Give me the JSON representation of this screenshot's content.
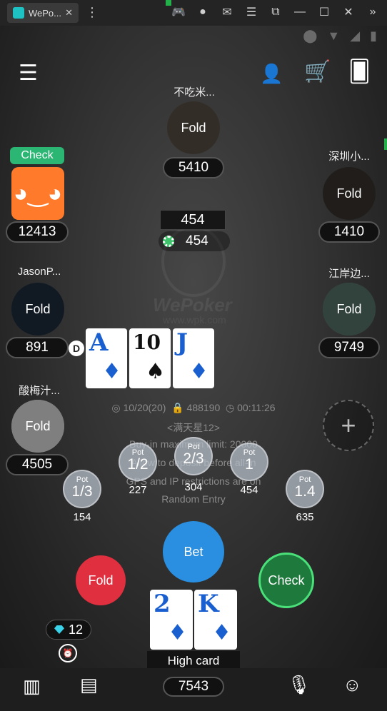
{
  "window": {
    "tab_title": "WePo...",
    "close": "✕"
  },
  "table_info": {
    "pot": "454",
    "pot_side": "454",
    "blinds": "10/20(20)",
    "room_id": "488190",
    "timer": "00:11:26",
    "club": "<满天星12>",
    "rule1": "Buy-in maximum limit: 20000",
    "rule2": "Allow to deposit before all-in",
    "rule3": "GPS and IP restrictions are on",
    "rule4": "Random Entry"
  },
  "logo": {
    "name": "WePoker",
    "url": "www.wpk.com"
  },
  "players": [
    {
      "name": "不吃米...",
      "status": "Fold",
      "stack": "5410"
    },
    {
      "name": "深圳小...",
      "status": "Fold",
      "stack": "1410"
    },
    {
      "name": "",
      "status": "",
      "stack": "12413",
      "action": "Check"
    },
    {
      "name": "JasonP...",
      "status": "Fold",
      "stack": "891"
    },
    {
      "name": "江岸边...",
      "status": "Fold",
      "stack": "9749"
    },
    {
      "name": "酸梅汁...",
      "status": "Fold",
      "stack": "4505"
    }
  ],
  "dealer": "D",
  "board": [
    {
      "rank": "A",
      "suit": "♦"
    },
    {
      "rank": "10",
      "suit": "♠"
    },
    {
      "rank": "J",
      "suit": "♦"
    }
  ],
  "pot_buttons": [
    {
      "label": "Pot",
      "fraction": "1/3",
      "amount": "154"
    },
    {
      "label": "Pot",
      "fraction": "1/2",
      "amount": "227"
    },
    {
      "label": "Pot",
      "fraction": "2/3",
      "amount": "304"
    },
    {
      "label": "Pot",
      "fraction": "1",
      "amount": "454"
    },
    {
      "label": "Pot",
      "fraction": "1.4",
      "amount": "635"
    }
  ],
  "actions": {
    "fold": "Fold",
    "bet": "Bet",
    "check": "Check"
  },
  "hero": {
    "cards": [
      {
        "rank": "2",
        "suit": "♦"
      },
      {
        "rank": "K",
        "suit": "♦"
      }
    ],
    "hand": "High card",
    "stack": "7543",
    "gems": "12"
  },
  "add_seat": "+"
}
